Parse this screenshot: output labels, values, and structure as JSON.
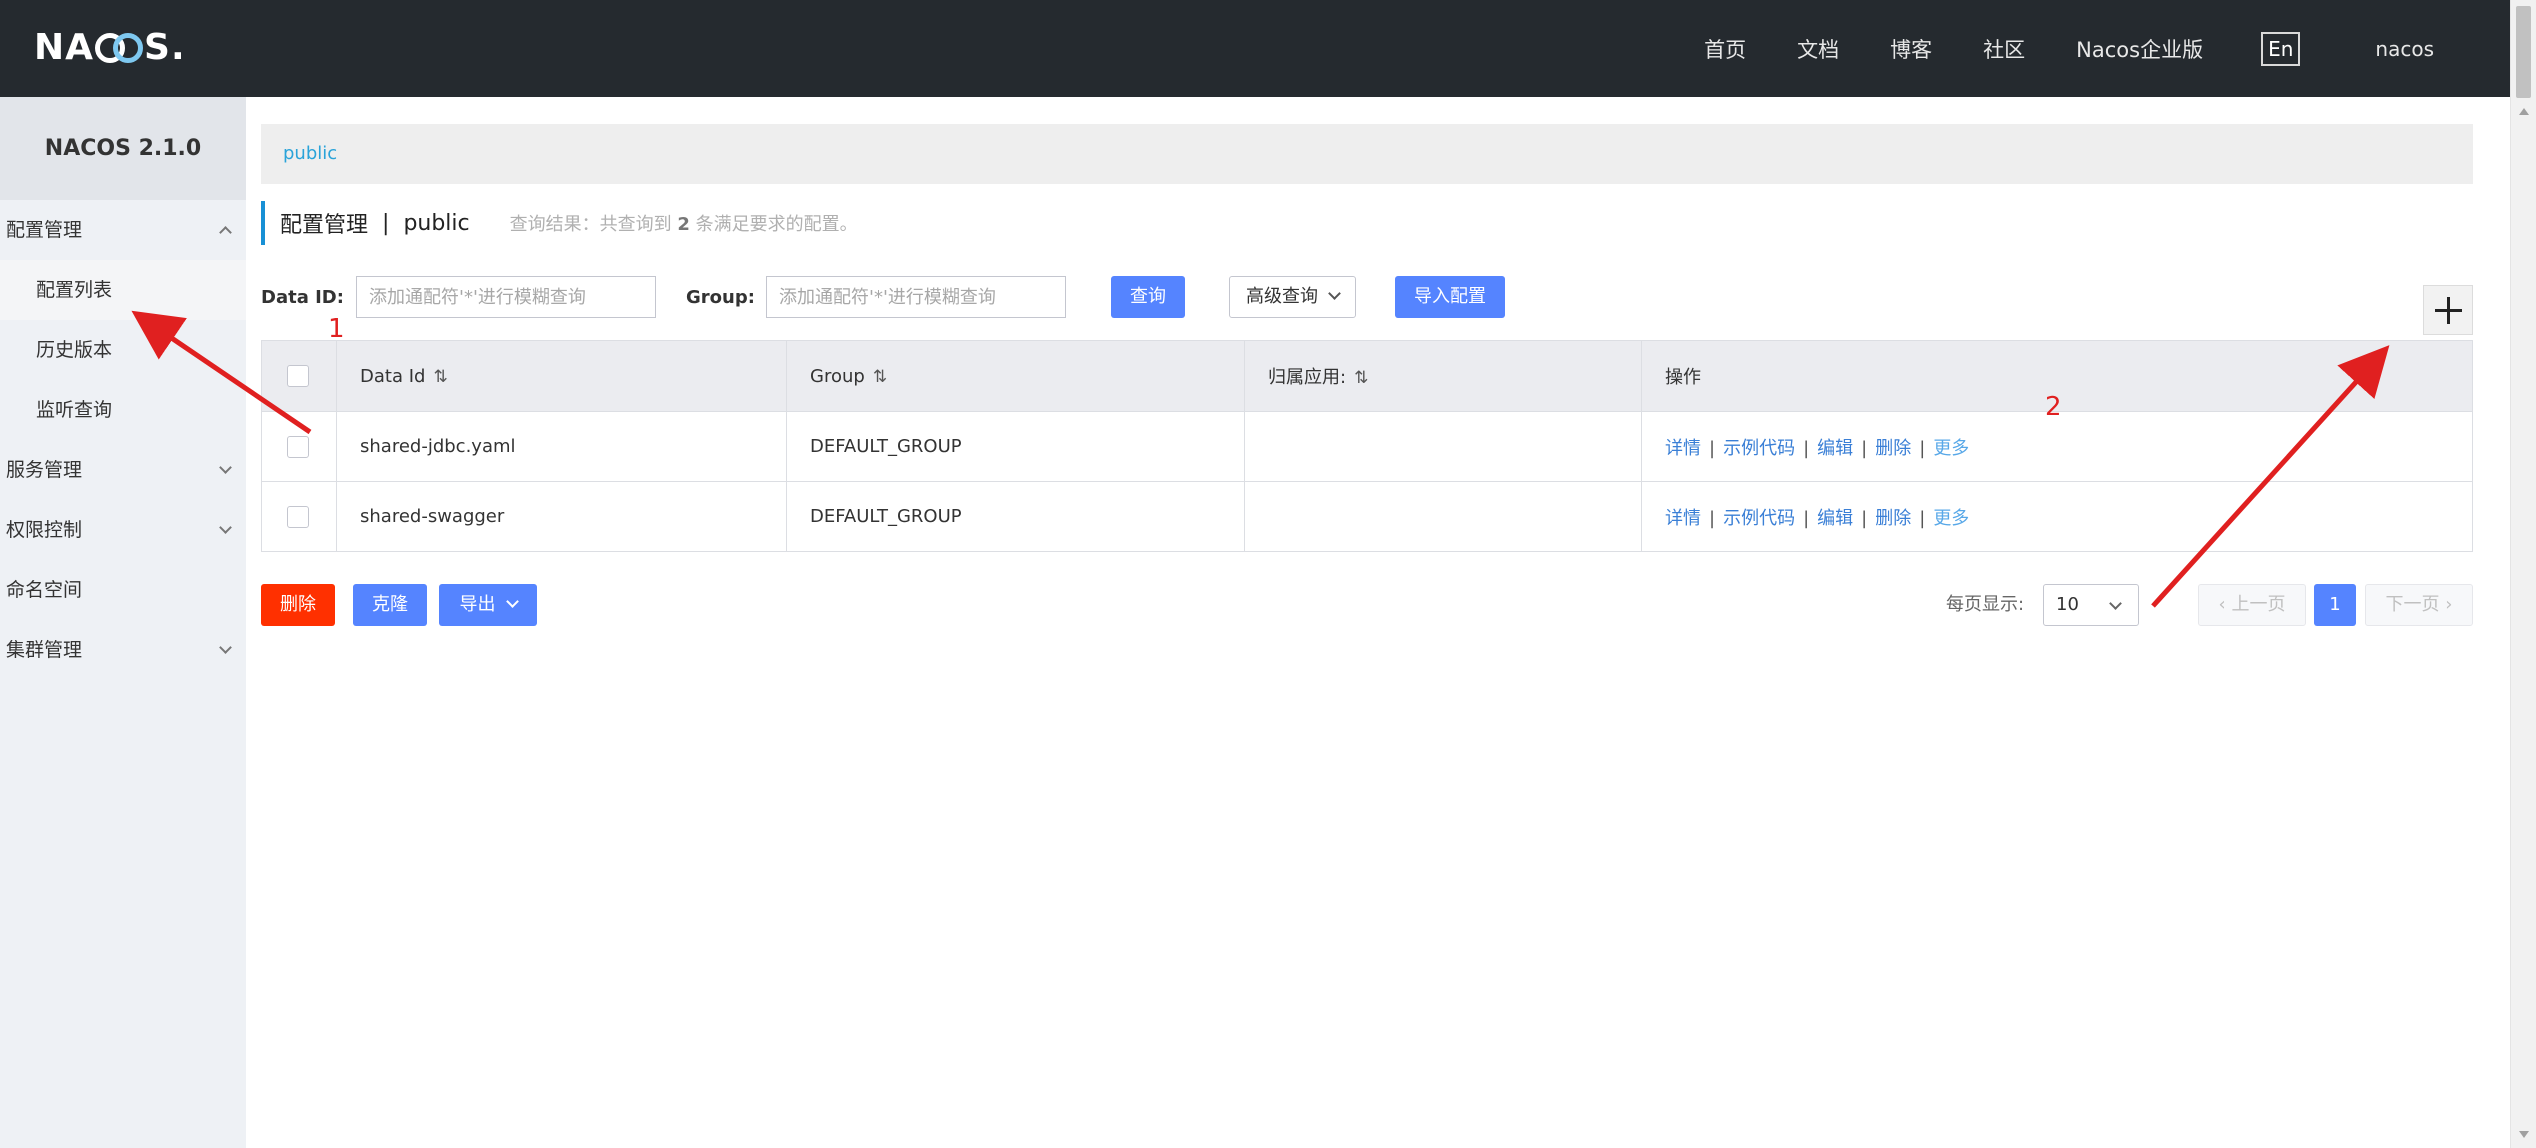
{
  "header": {
    "logo": "NACOS",
    "nav": [
      "首页",
      "文档",
      "博客",
      "社区",
      "Nacos企业版"
    ],
    "lang": "En",
    "user": "nacos"
  },
  "sidebar": {
    "version": "NACOS 2.1.0",
    "config_mgmt": "配置管理",
    "config_list": "配置列表",
    "history": "历史版本",
    "listener": "监听查询",
    "service_mgmt": "服务管理",
    "permission": "权限控制",
    "namespace": "命名空间",
    "cluster": "集群管理"
  },
  "breadcrumb": "public",
  "title": {
    "main": "配置管理",
    "sep": "|",
    "namespace": "public",
    "result_prefix": "查询结果：共查询到",
    "result_count": "2",
    "result_suffix": "条满足要求的配置。"
  },
  "search": {
    "data_id_label": "Data ID:",
    "data_id_placeholder": "添加通配符'*'进行模糊查询",
    "group_label": "Group:",
    "group_placeholder": "添加通配符'*'进行模糊查询",
    "query_btn": "查询",
    "advanced_btn": "高级查询",
    "import_btn": "导入配置"
  },
  "table": {
    "headers": [
      "Data Id",
      "Group",
      "归属应用:",
      "操作"
    ],
    "rows": [
      {
        "data_id": "shared-jdbc.yaml",
        "group": "DEFAULT_GROUP",
        "app": ""
      },
      {
        "data_id": "shared-swagger",
        "group": "DEFAULT_GROUP",
        "app": ""
      }
    ],
    "ops": {
      "detail": "详情",
      "sample": "示例代码",
      "edit": "编辑",
      "delete": "删除",
      "more": "更多",
      "sep": "|"
    }
  },
  "bottom": {
    "delete": "删除",
    "clone": "克隆",
    "export": "导出",
    "page_size_label": "每页显示:",
    "page_size": "10",
    "prev": "上一页",
    "current_page": "1",
    "next": "下一页"
  },
  "annotations": {
    "one": "1",
    "two": "2"
  },
  "colors": {
    "header_bg": "#252a2f",
    "primary": "#5584ff",
    "danger": "#ff3000",
    "annotation": "#e02020"
  }
}
